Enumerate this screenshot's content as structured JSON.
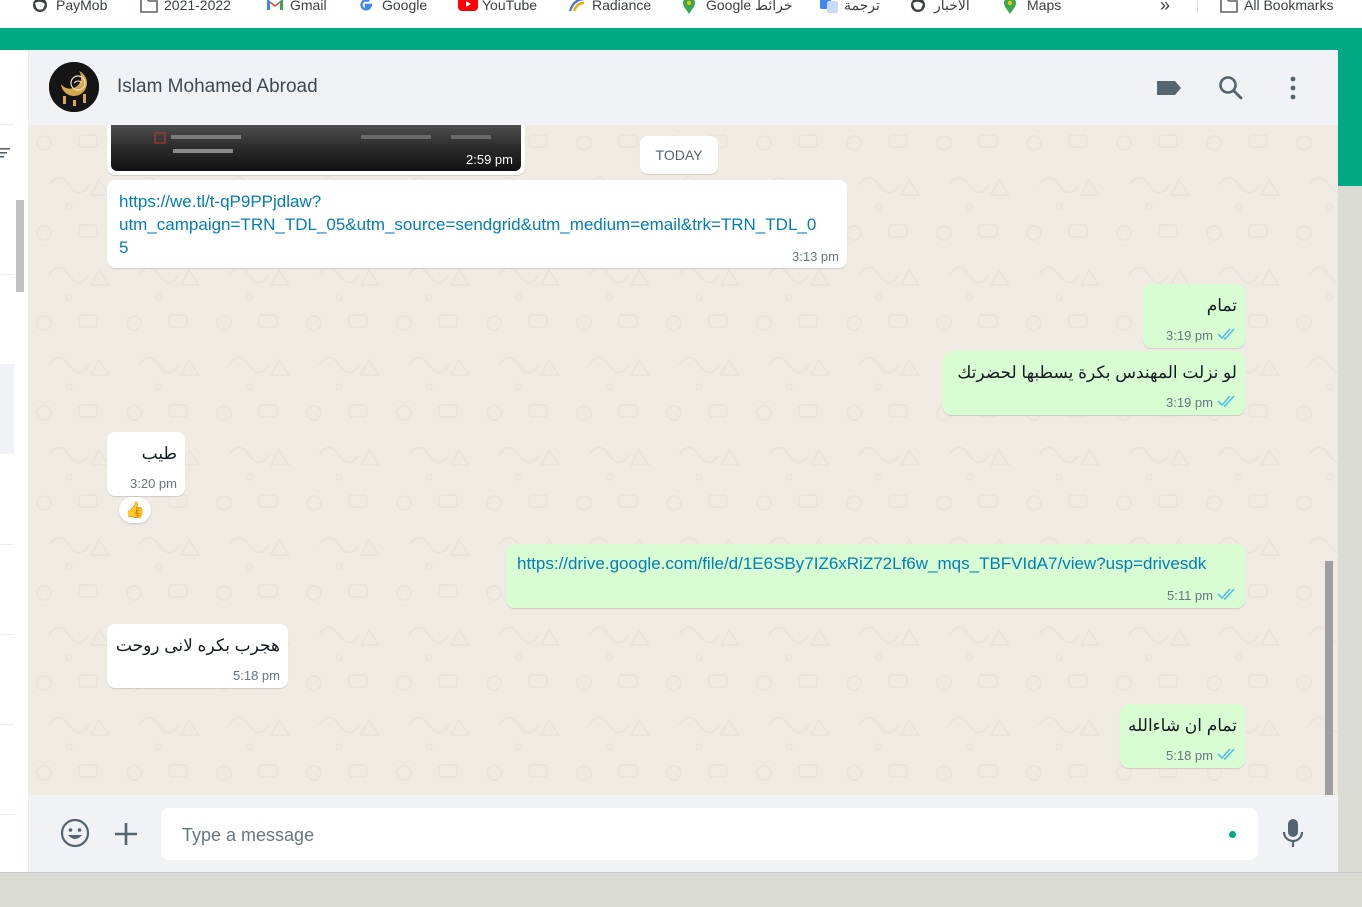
{
  "bookmarks": {
    "items": [
      {
        "label": "PayMob",
        "icon": "globe-icon"
      },
      {
        "label": "2021-2022",
        "icon": "folder-icon"
      },
      {
        "label": "Gmail",
        "icon": "gmail-icon"
      },
      {
        "label": "Google",
        "icon": "google-icon"
      },
      {
        "label": "YouTube",
        "icon": "youtube-icon"
      },
      {
        "label": "Radiance",
        "icon": "radiance-icon"
      },
      {
        "label": "Google خرائط",
        "icon": "maps-pin-icon"
      },
      {
        "label": "ترجمة",
        "icon": "translate-icon"
      },
      {
        "label": "الأخبار",
        "icon": "globe-icon"
      },
      {
        "label": "Maps",
        "icon": "maps-pin-icon"
      }
    ],
    "overflow": "»",
    "all_bookmarks": "All Bookmarks"
  },
  "header": {
    "contact_name": "Islam Mohamed Abroad",
    "icons": [
      "label-icon",
      "search-icon",
      "more-vertical-icon"
    ]
  },
  "messages": {
    "image_time": "2:59 pm",
    "date_divider": "TODAY",
    "m1": {
      "text": "https://we.tl/t-qP9PPjdlaw?utm_campaign=TRN_TDL_05&utm_source=sendgrid&utm_medium=email&trk=TRN_TDL_05",
      "line1": "https://we.tl/t-qP9PPjdlaw?",
      "line2": "utm_campaign=TRN_TDL_05&utm_source=sendgrid&utm_medium=email&trk=TRN_TDL_0",
      "line3": "5",
      "time": "3:13 pm",
      "direction": "in"
    },
    "m2": {
      "text": "تمام",
      "time": "3:19 pm",
      "direction": "out",
      "status": "read"
    },
    "m3": {
      "text": "لو نزلت المهندس بكرة يسطبها لحضرتك",
      "time": "3:19 pm",
      "direction": "out",
      "status": "read"
    },
    "m4": {
      "text": "طيب",
      "time": "3:20 pm",
      "direction": "in",
      "reaction": "👍"
    },
    "m5": {
      "text": "https://drive.google.com/file/d/1E6SBy7IZ6xRiZ72Lf6w_mqs_TBFVIdA7/view?usp=drivesdk",
      "time": "5:11 pm",
      "direction": "out",
      "status": "read"
    },
    "m6": {
      "text": "هجرب بكره لانى روحت",
      "time": "5:18 pm",
      "direction": "in"
    },
    "m7": {
      "text": "تمام ان شاءالله",
      "time": "5:18 pm",
      "direction": "out",
      "status": "read"
    }
  },
  "composer": {
    "placeholder": "Type a message",
    "icons": [
      "emoji-icon",
      "attach-plus-icon",
      "microphone-icon"
    ]
  },
  "colors": {
    "accent": "#00a884",
    "outgoing_bubble": "#d9fdd3",
    "incoming_bubble": "#ffffff",
    "chat_background": "#efeae2",
    "link": "#027eb5",
    "read_ticks": "#53bdeb"
  }
}
